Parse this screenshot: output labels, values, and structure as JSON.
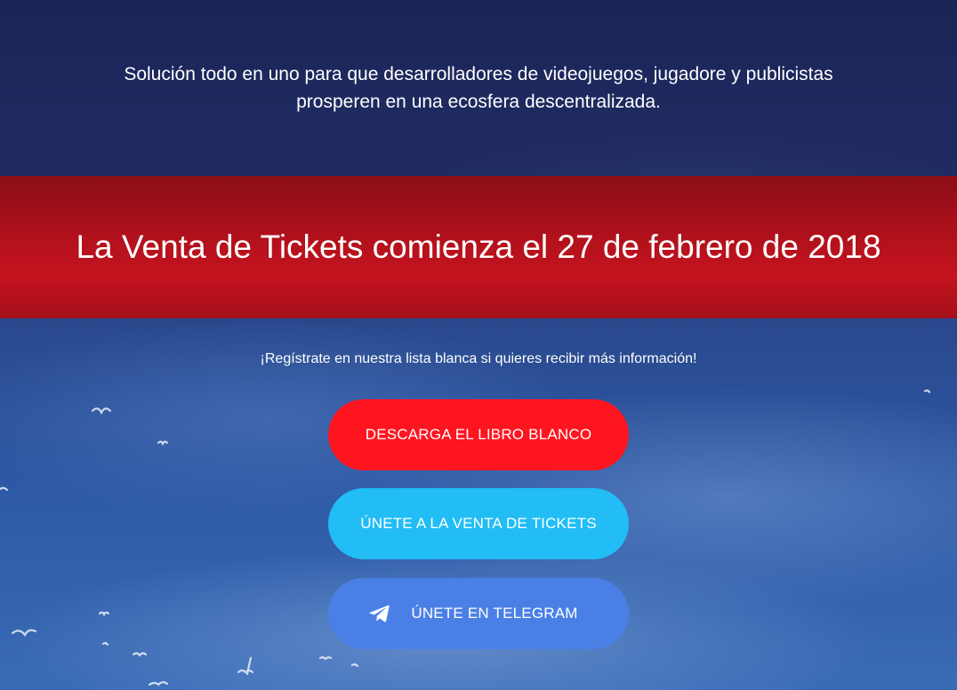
{
  "hero": {
    "tagline_line1": "Solución todo en uno para que desarrolladores de videojuegos, jugadore y publicistas",
    "tagline_line2": "prosperen en una ecosfera descentralizada."
  },
  "announcement": {
    "headline": "La Venta de Tickets comienza el 27 de febrero de 2018"
  },
  "signup": {
    "whitelist_text": "¡Regístrate en nuestra lista blanca si quieres recibir más información!"
  },
  "buttons": {
    "whitepaper_label": "DESCARGA EL LIBRO BLANCO",
    "tokensale_label": "ÚNETE A LA VENTA DE TICKETS",
    "telegram_label": "ÚNETE EN TELEGRAM"
  },
  "icons": {
    "telegram": "telegram-icon",
    "birds": "seagull-decoration"
  },
  "colors": {
    "top_band": "#1b2456",
    "red_band": "#b3111c",
    "whitepaper_button": "#ff1520",
    "tokensale_button": "#22bdf5",
    "telegram_button": "#4a80e6"
  }
}
